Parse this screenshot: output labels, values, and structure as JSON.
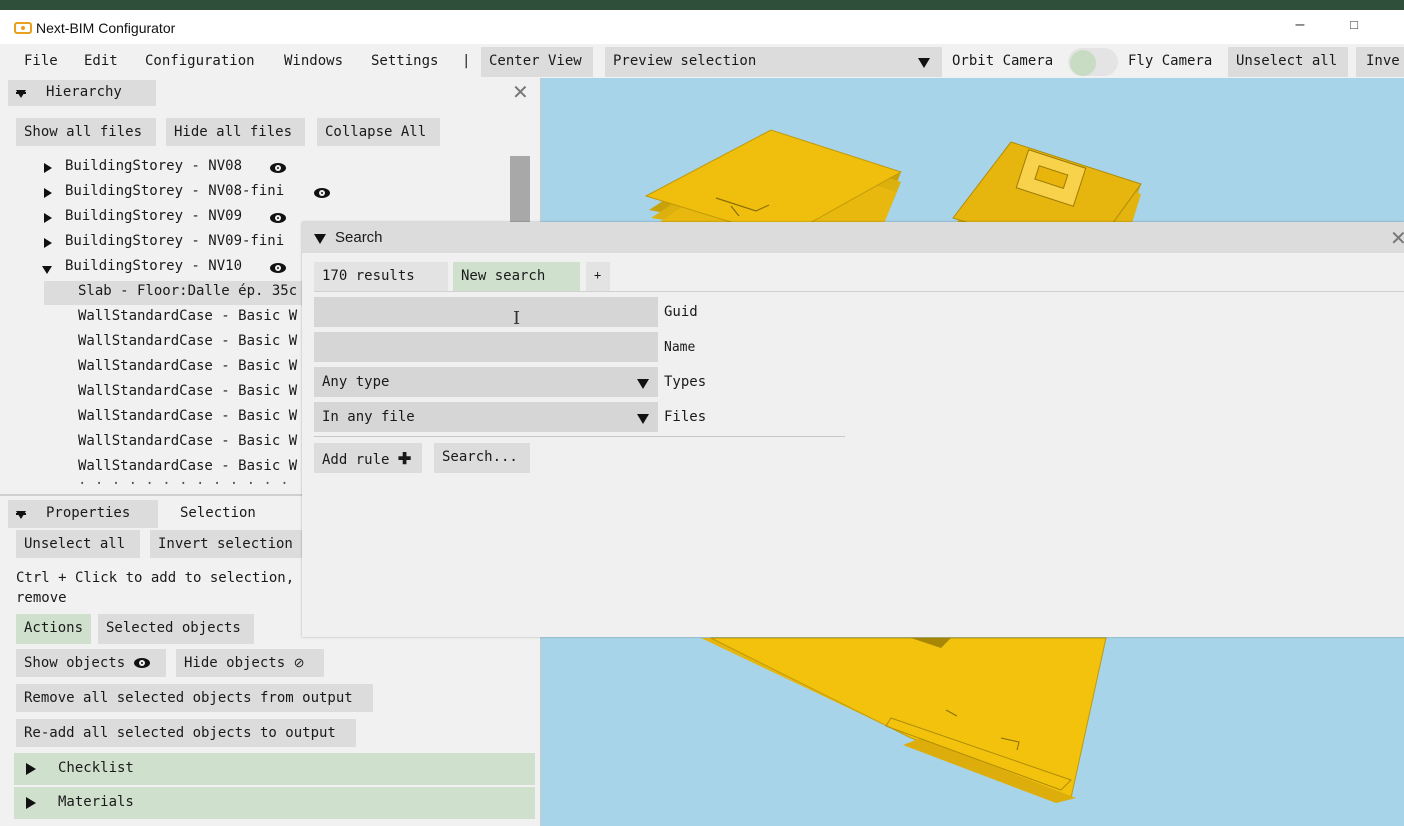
{
  "window": {
    "title": "Next-BIM Configurator",
    "minimize": "–",
    "maximize": "□"
  },
  "menu": {
    "file": "File",
    "edit": "Edit",
    "configuration": "Configuration",
    "windows": "Windows",
    "settings": "Settings",
    "separator": "|",
    "center_view": "Center View",
    "preview_selection": "Preview selection",
    "orbit_camera": "Orbit Camera",
    "fly_camera": "Fly Camera",
    "unselect_all": "Unselect all",
    "invert_partial": "Inve"
  },
  "hierarchy": {
    "title": "Hierarchy",
    "show_all_files": "Show all files",
    "hide_all_files": "Hide all files",
    "collapse_all": "Collapse All",
    "rows": [
      {
        "label": "BuildingStorey - NV08"
      },
      {
        "label": "BuildingStorey - NV08-fini"
      },
      {
        "label": "BuildingStorey - NV09"
      },
      {
        "label": "BuildingStorey - NV09-fini"
      },
      {
        "label": "BuildingStorey - NV10"
      }
    ],
    "children": [
      "Slab - Floor:Dalle ép. 35c",
      "WallStandardCase - Basic W",
      "WallStandardCase - Basic W",
      "WallStandardCase - Basic W",
      "WallStandardCase - Basic W",
      "WallStandardCase - Basic W",
      "WallStandardCase - Basic W",
      "WallStandardCase - Basic W"
    ]
  },
  "properties": {
    "tab_properties": "Properties",
    "tab_selection": "Selection",
    "unselect_all": "Unselect all",
    "invert_selection": "Invert selection",
    "hint_line1": "Ctrl + Click to add to selection,",
    "hint_line2": "remove",
    "tab_actions": "Actions",
    "tab_selected_objects": "Selected objects",
    "show_objects": "Show objects",
    "hide_objects": "Hide objects",
    "remove_all": "Remove all selected objects from output",
    "readd_all": "Re-add all selected objects to output",
    "checklist": "Checklist",
    "materials": "Materials"
  },
  "search": {
    "title": "Search",
    "results": "170 results",
    "new_search": "New search",
    "add_tab": "+",
    "guid_label": "Guid",
    "guid_value": "",
    "name_label": "Name",
    "name_value": "",
    "types_value": "Any type",
    "types_label": "Types",
    "files_value": "In any file",
    "files_label": "Files",
    "add_rule": "Add rule",
    "search_button": "Search..."
  },
  "colors": {
    "viewport_sky": "#a8d4ea",
    "slab_yellow": "#f2c20c",
    "slab_dark": "#c9a20a",
    "button_grey": "#dcdcdc",
    "active_green": "#cfe0cd"
  }
}
